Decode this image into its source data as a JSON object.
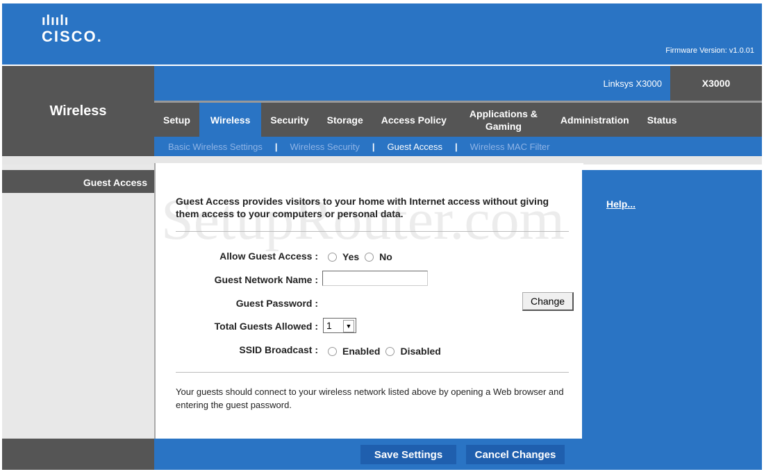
{
  "header": {
    "logo_bars": "ılıılı",
    "logo_text": "CISCO.",
    "firmware": "Firmware Version: v1.0.01",
    "section": "Wireless",
    "model_name": "Linksys X3000",
    "model": "X3000"
  },
  "tabs": [
    {
      "label": "Setup"
    },
    {
      "label": "Wireless",
      "active": true
    },
    {
      "label": "Security"
    },
    {
      "label": "Storage"
    },
    {
      "label": "Access Policy"
    },
    {
      "label": "Applications &\nGaming"
    },
    {
      "label": "Administration"
    },
    {
      "label": "Status"
    }
  ],
  "subtabs": [
    {
      "label": "Basic Wireless Settings"
    },
    {
      "label": "Wireless Security"
    },
    {
      "label": "Guest Access",
      "active": true
    },
    {
      "label": "Wireless MAC Filter"
    }
  ],
  "sidebar": {
    "item": "Guest Access"
  },
  "help": "Help...",
  "watermark": "SetupRouter.com",
  "main": {
    "intro": "Guest Access provides visitors to your home with Internet access without giving them access to your computers or personal data.",
    "allow_label": "Allow Guest Access :",
    "yes": "Yes",
    "no": "No",
    "name_label": "Guest Network Name :",
    "name_value": "",
    "password_label": "Guest Password :",
    "change": "Change",
    "total_label": "Total Guests Allowed :",
    "total_value": "1",
    "ssid_label": "SSID Broadcast :",
    "enabled": "Enabled",
    "disabled": "Disabled",
    "note": "Your guests should connect to your wireless network listed above by opening a Web browser and entering the guest password."
  },
  "footer": {
    "save": "Save Settings",
    "cancel": "Cancel Changes"
  },
  "colors": {
    "brand_blue": "#2a74c4",
    "dark_gray": "#555555"
  }
}
